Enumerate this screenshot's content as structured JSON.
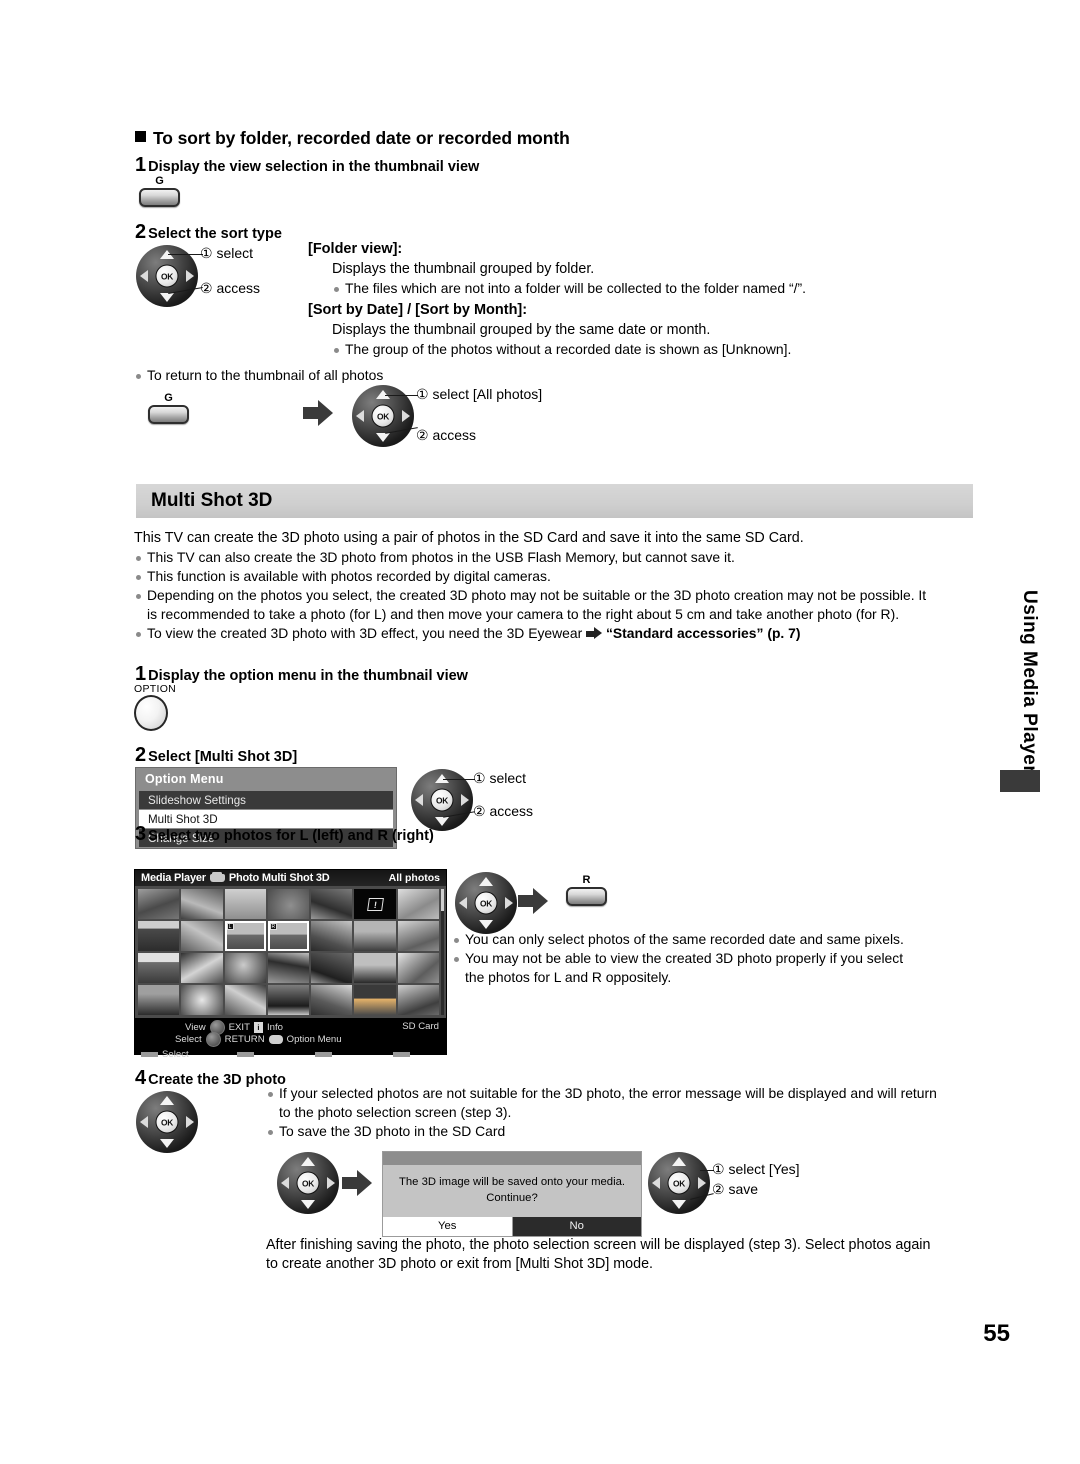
{
  "section1": {
    "heading": "To sort by folder, recorded date or recorded month",
    "step1_num": "1",
    "step1_title": "Display the view selection in the thumbnail view",
    "g_button_label": "G",
    "step2_num": "2",
    "step2_title": "Select the sort type",
    "callout_select": "① select",
    "callout_access": "② access",
    "ok_label": "OK",
    "folder_view_head": "[Folder view]:",
    "folder_view_body": "Displays the thumbnail grouped by folder.",
    "folder_view_bullet": "The files which are not into a folder will be collected to the folder named “/”.",
    "sort_head": "[Sort by Date] / [Sort by Month]:",
    "sort_body": "Displays the thumbnail grouped by the same date or month.",
    "sort_bullet": "The group of the photos without a recorded date is shown as [Unknown].",
    "return_bullet": "To return to the thumbnail of all photos",
    "callout_select_all": "① select [All photos]",
    "callout_access2": "② access"
  },
  "multishot": {
    "banner_title": "Multi Shot 3D",
    "intro": "This TV can create the 3D photo using a pair of photos in the SD Card and save it into the same SD Card.",
    "bullets": [
      "This TV can also create the 3D photo from photos in the USB Flash Memory, but cannot save it.",
      "This function is available with photos recorded by digital cameras.",
      "Depending on the photos you select, the created 3D photo may not be suitable or the 3D photo creation may not be possible. It is recommended to take a photo (for L) and then move your camera to the right about 5 cm and take another photo (for R)."
    ],
    "eyewear_bullet_pre": "To view the created 3D photo with 3D effect, you need the 3D Eyewear",
    "eyewear_bullet_link": "“Standard accessories” (p. 7)",
    "step1_num": "1",
    "step1_title": "Display the option menu in the thumbnail view",
    "option_button_label": "OPTION",
    "step2_num": "2",
    "step2_title": "Select [Multi Shot 3D]",
    "option_menu": {
      "title": "Option Menu",
      "items": [
        {
          "label": "Slideshow Settings",
          "state": "dark"
        },
        {
          "label": "Multi Shot 3D",
          "state": "sel"
        },
        {
          "label": "Change Size",
          "state": "dark"
        }
      ]
    },
    "callout_select": "① select",
    "callout_access": "② access",
    "step3_num": "3",
    "step3_title": "Select two photos for L (left) and R (right)",
    "r_button_label": "R",
    "step3_bullets": [
      "You can only select photos of the same recorded date and same pixels.",
      "You may not be able to view the created 3D photo properly if you select the photos for L and R oppositely."
    ],
    "step4_num": "4",
    "step4_title": "Create the 3D photo",
    "step4_bullets": [
      "If your selected photos are not suitable for the 3D photo, the error message will be displayed and will return to the photo selection screen (step 3).",
      "To save the 3D photo in the SD Card"
    ],
    "dialog": {
      "message_line1": "The 3D image will be saved onto your media.",
      "message_line2": "Continue?",
      "yes": "Yes",
      "no": "No"
    },
    "callout_select_yes": "① select [Yes]",
    "callout_save": "② save",
    "closing": "After finishing saving the photo, the photo selection screen will be displayed (step 3). Select photos again to create another 3D photo or exit from [Multi Shot 3D] mode."
  },
  "media_player": {
    "title": "Media Player",
    "subtitle": "Photo Multi Shot 3D",
    "mode": "All photos",
    "badge_l": "L",
    "badge_r": "R",
    "footer": {
      "view": "View",
      "select": "Select",
      "exit": "EXIT",
      "return": "RETURN",
      "info": "Info",
      "option_menu": "Option Menu",
      "source": "SD Card",
      "select_color": "Select"
    }
  },
  "side_tab": {
    "label": "Using Media Player"
  },
  "page_number": "55",
  "colors": {
    "banner": "#cfcfcf",
    "menu_dark": "#3a3a3a",
    "menu_gray": "#8d8d8d",
    "dialog_body": "#c4c4c4"
  }
}
